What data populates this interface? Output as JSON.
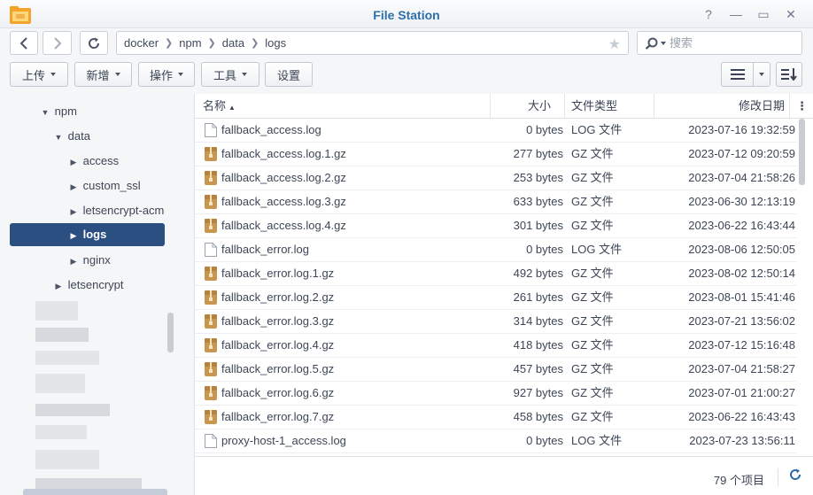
{
  "window": {
    "title": "File Station",
    "app_icon": "folder-app-icon",
    "controls": [
      "help-icon",
      "minimize-icon",
      "maximize-icon",
      "close-icon"
    ]
  },
  "nav": {
    "back_icon": "chevron-left-icon",
    "forward_icon": "chevron-right-icon",
    "refresh_icon": "refresh-icon",
    "breadcrumbs": [
      "docker",
      "npm",
      "data",
      "logs"
    ],
    "search_placeholder": "搜索"
  },
  "toolbar": {
    "upload": "上传",
    "create": "新增",
    "action": "操作",
    "tools": "工具",
    "settings": "设置"
  },
  "sidebar": {
    "items": [
      {
        "label": "npm",
        "arrow": "▼"
      },
      {
        "label": "data",
        "arrow": "▼"
      },
      {
        "label": "access",
        "arrow": "▶"
      },
      {
        "label": "custom_ssl",
        "arrow": "▶"
      },
      {
        "label": "letsencrypt-acme-challenge",
        "arrow": "▶"
      },
      {
        "label": "logs",
        "arrow": "▶"
      },
      {
        "label": "nginx",
        "arrow": "▶"
      },
      {
        "label": "letsencrypt",
        "arrow": "▶"
      }
    ]
  },
  "columns": {
    "name": "名称",
    "sort_indicator": "▲",
    "size": "大小",
    "type": "文件类型",
    "modified": "修改日期",
    "menu": "⋮"
  },
  "files": [
    {
      "name": "fallback_access.log",
      "size": "0 bytes",
      "type": "LOG 文件",
      "modified": "2023-07-16 19:32:59",
      "kind": "log"
    },
    {
      "name": "fallback_access.log.1.gz",
      "size": "277 bytes",
      "type": "GZ 文件",
      "modified": "2023-07-12 09:20:59",
      "kind": "gz"
    },
    {
      "name": "fallback_access.log.2.gz",
      "size": "253 bytes",
      "type": "GZ 文件",
      "modified": "2023-07-04 21:58:26",
      "kind": "gz"
    },
    {
      "name": "fallback_access.log.3.gz",
      "size": "633 bytes",
      "type": "GZ 文件",
      "modified": "2023-06-30 12:13:19",
      "kind": "gz"
    },
    {
      "name": "fallback_access.log.4.gz",
      "size": "301 bytes",
      "type": "GZ 文件",
      "modified": "2023-06-22 16:43:44",
      "kind": "gz"
    },
    {
      "name": "fallback_error.log",
      "size": "0 bytes",
      "type": "LOG 文件",
      "modified": "2023-08-06 12:50:05",
      "kind": "log"
    },
    {
      "name": "fallback_error.log.1.gz",
      "size": "492 bytes",
      "type": "GZ 文件",
      "modified": "2023-08-02 12:50:14",
      "kind": "gz"
    },
    {
      "name": "fallback_error.log.2.gz",
      "size": "261 bytes",
      "type": "GZ 文件",
      "modified": "2023-08-01 15:41:46",
      "kind": "gz"
    },
    {
      "name": "fallback_error.log.3.gz",
      "size": "314 bytes",
      "type": "GZ 文件",
      "modified": "2023-07-21 13:56:02",
      "kind": "gz"
    },
    {
      "name": "fallback_error.log.4.gz",
      "size": "418 bytes",
      "type": "GZ 文件",
      "modified": "2023-07-12 15:16:48",
      "kind": "gz"
    },
    {
      "name": "fallback_error.log.5.gz",
      "size": "457 bytes",
      "type": "GZ 文件",
      "modified": "2023-07-04 21:58:27",
      "kind": "gz"
    },
    {
      "name": "fallback_error.log.6.gz",
      "size": "927 bytes",
      "type": "GZ 文件",
      "modified": "2023-07-01 21:00:27",
      "kind": "gz"
    },
    {
      "name": "fallback_error.log.7.gz",
      "size": "458 bytes",
      "type": "GZ 文件",
      "modified": "2023-06-22 16:43:43",
      "kind": "gz"
    },
    {
      "name": "proxy-host-1_access.log",
      "size": "0 bytes",
      "type": "LOG 文件",
      "modified": "2023-07-23 13:56:11",
      "kind": "log"
    }
  ],
  "footer": {
    "item_count": "79 个项目"
  },
  "colors": {
    "accent": "#2b4f80",
    "title": "#2d6fa8",
    "gz_icon": "#c8974f"
  }
}
